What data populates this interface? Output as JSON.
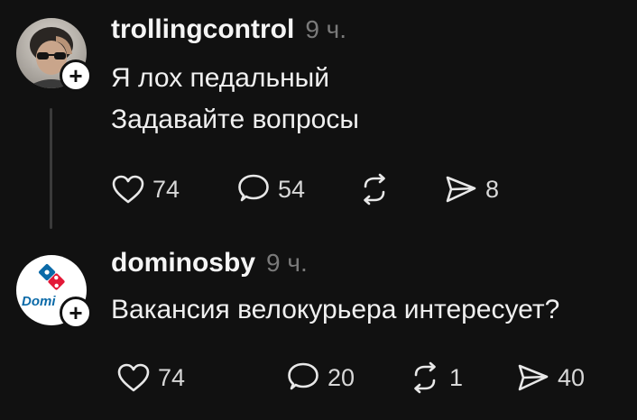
{
  "posts": [
    {
      "username": "trollingcontrol",
      "time": "9 ч.",
      "lines": [
        "Я лох педальный",
        "Задавайте вопросы"
      ],
      "actions": {
        "likes": "74",
        "comments": "54",
        "reposts": "",
        "shares": "8"
      }
    },
    {
      "username": "dominosby",
      "time": "9 ч.",
      "lines": [
        "Вакансия велокурьера интересует?"
      ],
      "avatar_text": "Domi",
      "actions": {
        "likes": "74",
        "comments": "20",
        "reposts": "1",
        "shares": "40"
      }
    }
  ],
  "icons": {
    "follow": "plus-icon",
    "like": "heart-icon",
    "comment": "comment-bubble-icon",
    "repost": "repost-icon",
    "share": "send-icon"
  },
  "colors": {
    "background": "#111111",
    "text": "#f3f3f3",
    "muted": "#7a7a7a",
    "dominos_blue": "#0b6aa8",
    "dominos_red": "#e31837"
  },
  "badge_symbol": "+"
}
